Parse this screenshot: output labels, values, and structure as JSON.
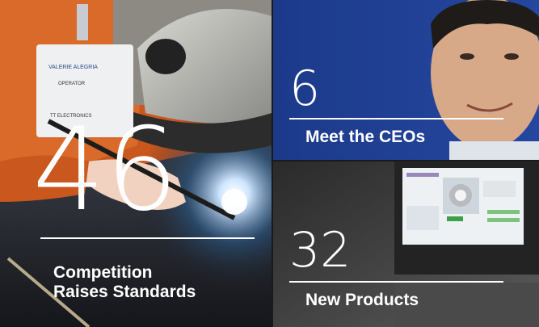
{
  "stories": [
    {
      "number": "46",
      "title_line1": "Competition",
      "title_line2": "Raises Standards"
    },
    {
      "number": "6",
      "title": "Meet the CEOs"
    },
    {
      "number": "32",
      "title": "New Products"
    }
  ],
  "badge": {
    "line1": "VALERIE ALEGRIA",
    "line2": "OPERATOR",
    "line3": "TT ELECTRONICS"
  }
}
